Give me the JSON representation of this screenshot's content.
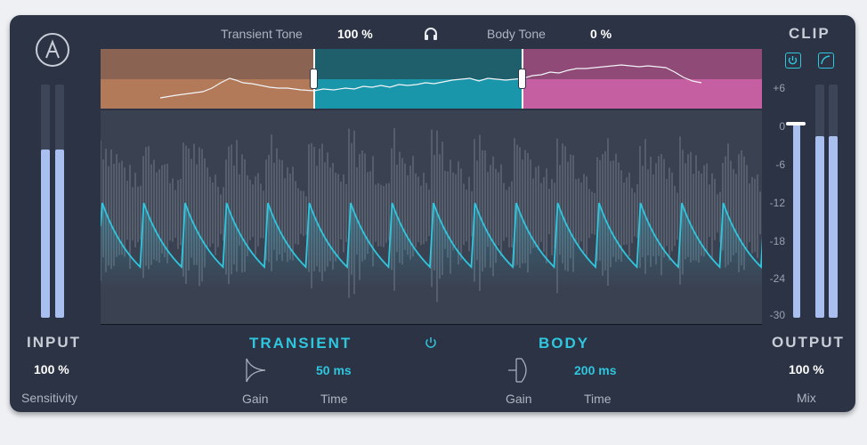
{
  "header": {
    "transient_tone_label": "Transient Tone",
    "transient_tone_value": "100 %",
    "body_tone_label": "Body Tone",
    "body_tone_value": "0 %",
    "headphones_icon": "headphones-icon"
  },
  "input": {
    "title": "INPUT",
    "value": "100 %",
    "label": "Sensitivity",
    "meter_levels": [
      0.72,
      0.72
    ]
  },
  "output": {
    "title": "OUTPUT",
    "value": "100 %",
    "label": "Mix",
    "meter_levels": [
      0.78,
      0.78
    ],
    "clip_label": "CLIP",
    "scale": [
      "+6",
      "0",
      "-6",
      "-12",
      "-18",
      "-24",
      "-30"
    ]
  },
  "transient": {
    "title": "TRANSIENT",
    "gain_label": "Gain",
    "time_value": "50 ms",
    "time_label": "Time"
  },
  "body": {
    "title": "BODY",
    "gain_label": "Gain",
    "time_value": "200 ms",
    "time_label": "Time"
  },
  "colors": {
    "panel": "#2b3344",
    "transient_band": "#9a6a50",
    "mid_band": "#1c8a9c",
    "body_band": "#c25fa0",
    "accent": "#2fc6de",
    "waveform": "#5d6574"
  }
}
